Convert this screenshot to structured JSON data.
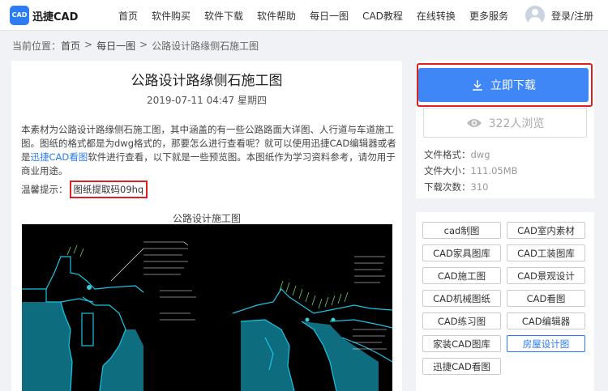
{
  "header": {
    "logo_mark": "CAD",
    "logo_text": "迅捷CAD",
    "nav": [
      "首页",
      "软件购买",
      "软件下载",
      "软件帮助",
      "每日一图",
      "CAD教程",
      "在线转换",
      "更多服务"
    ],
    "login": "登录/注册"
  },
  "breadcrumb": {
    "label": "当前位置：",
    "items": [
      "首页",
      "每日一图",
      "公路设计路缘侧石施工图"
    ],
    "sep": ">"
  },
  "article": {
    "title": "公路设计路缘侧石施工图",
    "date": "2019-07-11 04:47 星期四",
    "desc_before": "本素材为公路设计路缘侧石施工图，其中涵盖的有一些公路路面大详图、人行道与车道施工图。图纸的格式都是为dwg格式的，那要怎么进行查看呢？就可以使用迅捷CAD编辑器或者是",
    "desc_link": "迅捷CAD看图",
    "desc_after": "软件进行查看，以下就是一些预览图。本图纸作为学习资料参考，请勿用于商业用途。",
    "tip_label": "温馨提示：",
    "tip_code": "图纸提取码09hq",
    "preview_caption": "公路设计施工图"
  },
  "sidebar": {
    "download_label": "立即下载",
    "views": "322人浏览",
    "info": [
      {
        "label": "文件格式：",
        "value": "dwg"
      },
      {
        "label": "文件大小：",
        "value": "111.05MB"
      },
      {
        "label": "下载次数：",
        "value": "310"
      }
    ],
    "tags": [
      "cad制图",
      "CAD室内素材",
      "CAD家具图库",
      "CAD工装图库",
      "CAD施工图",
      "CAD景观设计",
      "CAD机械图纸",
      "CAD看图",
      "CAD练习图",
      "CAD编辑器",
      "家装CAD图库",
      "房屋设计图",
      "迅捷CAD看图"
    ],
    "active_tag": "房屋设计图"
  },
  "colors": {
    "accent": "#3f86f7",
    "highlight_red": "#e02020",
    "drawing_bg": "#000000",
    "drawing_cyan": "#19c6e6"
  },
  "icons": [
    "download-icon",
    "eye-icon",
    "avatar-icon"
  ]
}
